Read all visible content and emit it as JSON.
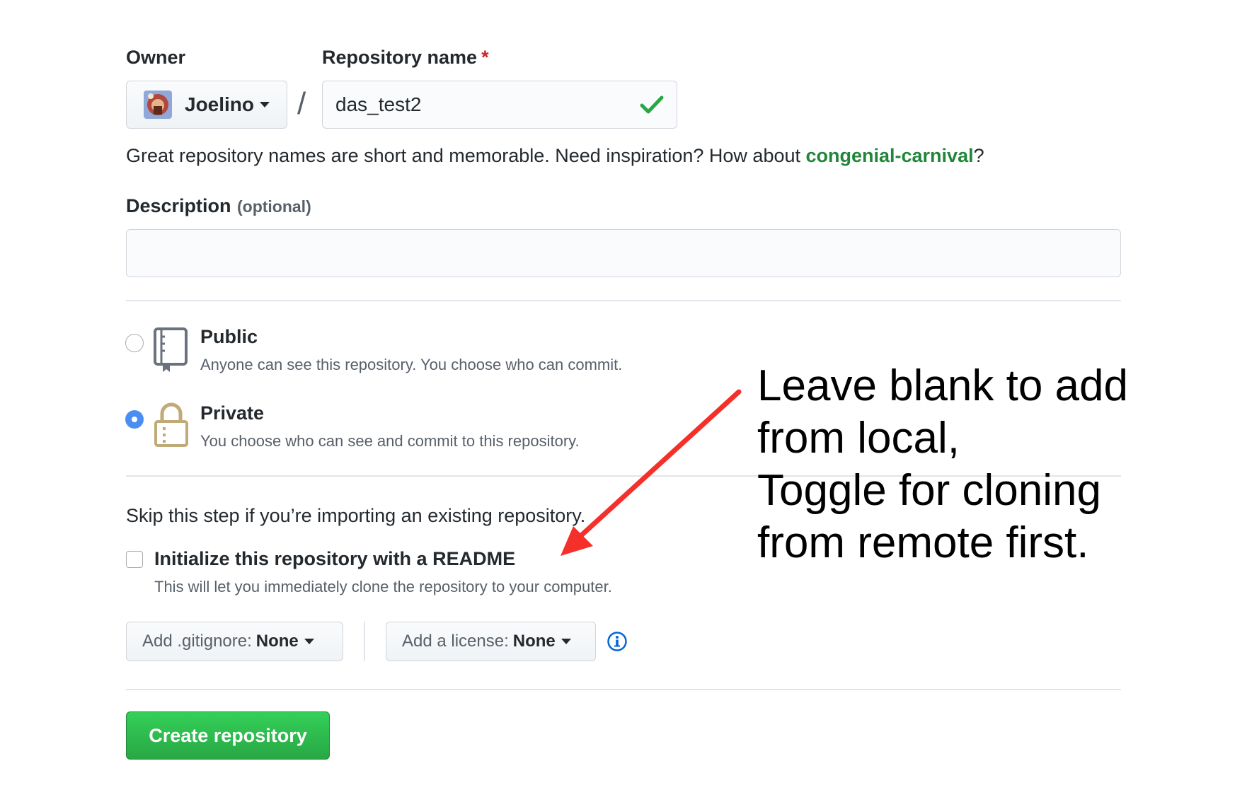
{
  "owner": {
    "label": "Owner",
    "value": "Joelino"
  },
  "separator": "/",
  "repo_name": {
    "label": "Repository name",
    "required_mark": "*",
    "value": "das_test2"
  },
  "name_hint": {
    "text": "Great repository names are short and memorable. Need inspiration? How about ",
    "suggestion": "congenial-carnival",
    "suffix": "?"
  },
  "description": {
    "label": "Description",
    "optional": "(optional)",
    "value": ""
  },
  "visibility": {
    "public": {
      "title": "Public",
      "desc": "Anyone can see this repository. You choose who can commit.",
      "selected": false
    },
    "private": {
      "title": "Private",
      "desc": "You choose who can see and commit to this repository.",
      "selected": true
    }
  },
  "init": {
    "skip_text": "Skip this step if you’re importing an existing repository.",
    "readme_label": "Initialize this repository with a README",
    "readme_desc": "This will let you immediately clone the repository to your computer.",
    "readme_checked": false
  },
  "gitignore": {
    "label": "Add .gitignore: ",
    "value": "None"
  },
  "license": {
    "label": "Add a license: ",
    "value": "None"
  },
  "create_button": "Create repository",
  "annotation": {
    "lines": [
      "Leave blank to add",
      "from local,",
      "Toggle for cloning",
      "from remote first."
    ],
    "arrow_color": "#f5302a"
  },
  "colors": {
    "create_green": "#2ea44f",
    "suggestion_green": "#22863a",
    "check_green": "#28a745",
    "info_blue": "#0366d6"
  }
}
